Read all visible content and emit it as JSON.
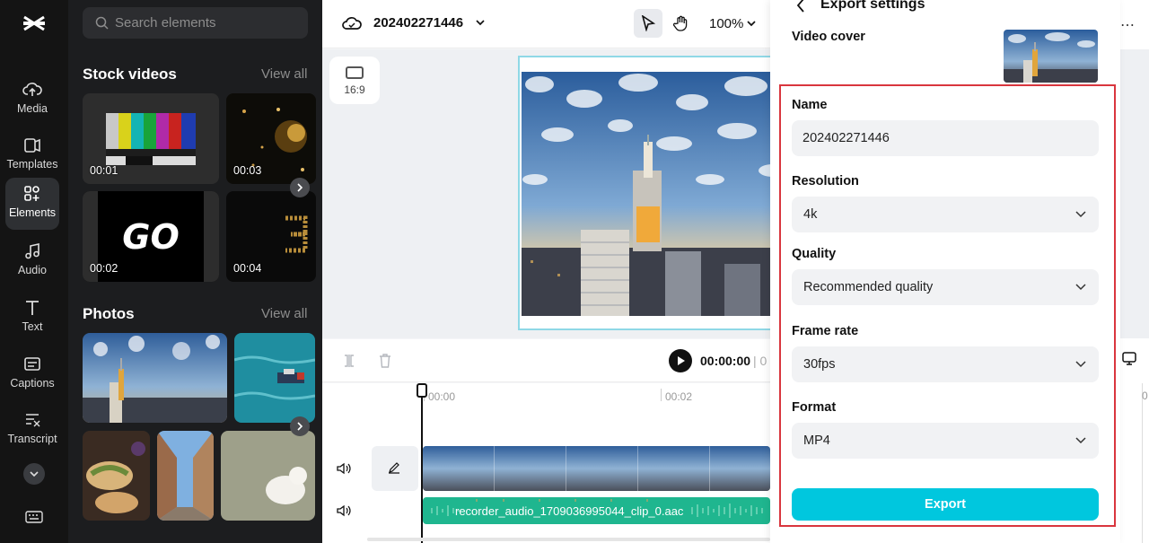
{
  "nav": {
    "items": [
      {
        "label": "Media",
        "icon": "cloud-upload-icon"
      },
      {
        "label": "Templates",
        "icon": "templates-icon"
      },
      {
        "label": "Elements",
        "icon": "elements-icon",
        "active": true
      },
      {
        "label": "Audio",
        "icon": "music-note-icon"
      },
      {
        "label": "Text",
        "icon": "text-icon"
      },
      {
        "label": "Captions",
        "icon": "captions-icon"
      },
      {
        "label": "Transcript",
        "icon": "transcript-icon"
      }
    ]
  },
  "panel": {
    "search_placeholder": "Search elements",
    "stock_videos": {
      "title": "Stock videos",
      "view_all": "View all",
      "durations": [
        "00:01",
        "00:03",
        "00:02",
        "00:04"
      ]
    },
    "photos": {
      "title": "Photos",
      "view_all": "View all"
    }
  },
  "topbar": {
    "project_title": "202402271446",
    "zoom": "100%"
  },
  "canvas": {
    "ratio_label": "16:9"
  },
  "timeline": {
    "current_time": "00:00:00",
    "separator": "| 0",
    "ruler": [
      "00:00",
      "00:02"
    ],
    "audio_clip_name": "recorder_audio_1709036995044_clip_0.aac"
  },
  "right_strip": {
    "ruler_tick": "0"
  },
  "export": {
    "title": "Export settings",
    "video_cover_label": "Video cover",
    "name_label": "Name",
    "name_value": "202402271446",
    "resolution_label": "Resolution",
    "resolution_value": "4k",
    "quality_label": "Quality",
    "quality_value": "Recommended quality",
    "frame_rate_label": "Frame rate",
    "frame_rate_value": "30fps",
    "format_label": "Format",
    "format_value": "MP4",
    "export_button": "Export",
    "accent_color": "#00c7de",
    "highlight_color": "#d9363e"
  }
}
